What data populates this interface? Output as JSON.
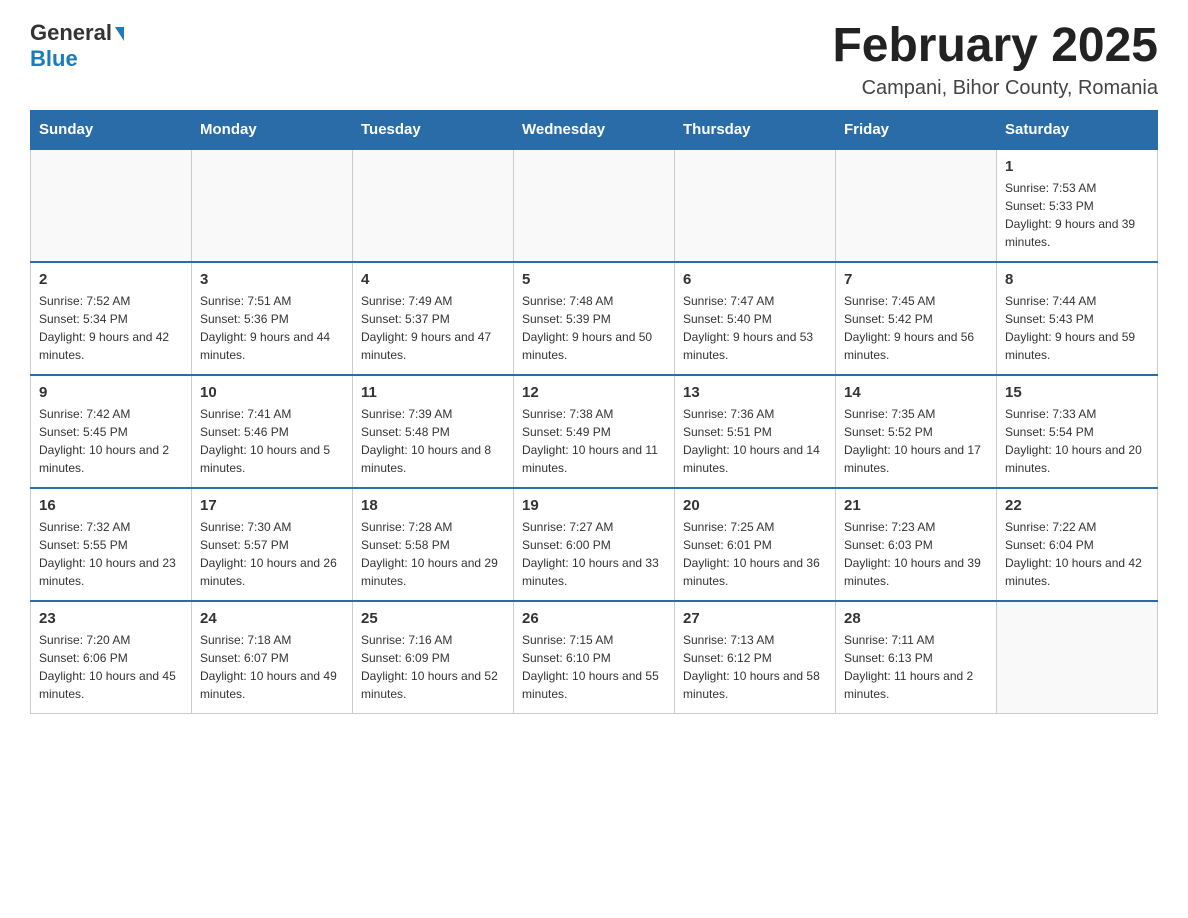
{
  "logo": {
    "general": "General",
    "blue": "Blue"
  },
  "title": "February 2025",
  "location": "Campani, Bihor County, Romania",
  "days_of_week": [
    "Sunday",
    "Monday",
    "Tuesday",
    "Wednesday",
    "Thursday",
    "Friday",
    "Saturday"
  ],
  "weeks": [
    [
      {
        "day": "",
        "info": ""
      },
      {
        "day": "",
        "info": ""
      },
      {
        "day": "",
        "info": ""
      },
      {
        "day": "",
        "info": ""
      },
      {
        "day": "",
        "info": ""
      },
      {
        "day": "",
        "info": ""
      },
      {
        "day": "1",
        "info": "Sunrise: 7:53 AM\nSunset: 5:33 PM\nDaylight: 9 hours and 39 minutes."
      }
    ],
    [
      {
        "day": "2",
        "info": "Sunrise: 7:52 AM\nSunset: 5:34 PM\nDaylight: 9 hours and 42 minutes."
      },
      {
        "day": "3",
        "info": "Sunrise: 7:51 AM\nSunset: 5:36 PM\nDaylight: 9 hours and 44 minutes."
      },
      {
        "day": "4",
        "info": "Sunrise: 7:49 AM\nSunset: 5:37 PM\nDaylight: 9 hours and 47 minutes."
      },
      {
        "day": "5",
        "info": "Sunrise: 7:48 AM\nSunset: 5:39 PM\nDaylight: 9 hours and 50 minutes."
      },
      {
        "day": "6",
        "info": "Sunrise: 7:47 AM\nSunset: 5:40 PM\nDaylight: 9 hours and 53 minutes."
      },
      {
        "day": "7",
        "info": "Sunrise: 7:45 AM\nSunset: 5:42 PM\nDaylight: 9 hours and 56 minutes."
      },
      {
        "day": "8",
        "info": "Sunrise: 7:44 AM\nSunset: 5:43 PM\nDaylight: 9 hours and 59 minutes."
      }
    ],
    [
      {
        "day": "9",
        "info": "Sunrise: 7:42 AM\nSunset: 5:45 PM\nDaylight: 10 hours and 2 minutes."
      },
      {
        "day": "10",
        "info": "Sunrise: 7:41 AM\nSunset: 5:46 PM\nDaylight: 10 hours and 5 minutes."
      },
      {
        "day": "11",
        "info": "Sunrise: 7:39 AM\nSunset: 5:48 PM\nDaylight: 10 hours and 8 minutes."
      },
      {
        "day": "12",
        "info": "Sunrise: 7:38 AM\nSunset: 5:49 PM\nDaylight: 10 hours and 11 minutes."
      },
      {
        "day": "13",
        "info": "Sunrise: 7:36 AM\nSunset: 5:51 PM\nDaylight: 10 hours and 14 minutes."
      },
      {
        "day": "14",
        "info": "Sunrise: 7:35 AM\nSunset: 5:52 PM\nDaylight: 10 hours and 17 minutes."
      },
      {
        "day": "15",
        "info": "Sunrise: 7:33 AM\nSunset: 5:54 PM\nDaylight: 10 hours and 20 minutes."
      }
    ],
    [
      {
        "day": "16",
        "info": "Sunrise: 7:32 AM\nSunset: 5:55 PM\nDaylight: 10 hours and 23 minutes."
      },
      {
        "day": "17",
        "info": "Sunrise: 7:30 AM\nSunset: 5:57 PM\nDaylight: 10 hours and 26 minutes."
      },
      {
        "day": "18",
        "info": "Sunrise: 7:28 AM\nSunset: 5:58 PM\nDaylight: 10 hours and 29 minutes."
      },
      {
        "day": "19",
        "info": "Sunrise: 7:27 AM\nSunset: 6:00 PM\nDaylight: 10 hours and 33 minutes."
      },
      {
        "day": "20",
        "info": "Sunrise: 7:25 AM\nSunset: 6:01 PM\nDaylight: 10 hours and 36 minutes."
      },
      {
        "day": "21",
        "info": "Sunrise: 7:23 AM\nSunset: 6:03 PM\nDaylight: 10 hours and 39 minutes."
      },
      {
        "day": "22",
        "info": "Sunrise: 7:22 AM\nSunset: 6:04 PM\nDaylight: 10 hours and 42 minutes."
      }
    ],
    [
      {
        "day": "23",
        "info": "Sunrise: 7:20 AM\nSunset: 6:06 PM\nDaylight: 10 hours and 45 minutes."
      },
      {
        "day": "24",
        "info": "Sunrise: 7:18 AM\nSunset: 6:07 PM\nDaylight: 10 hours and 49 minutes."
      },
      {
        "day": "25",
        "info": "Sunrise: 7:16 AM\nSunset: 6:09 PM\nDaylight: 10 hours and 52 minutes."
      },
      {
        "day": "26",
        "info": "Sunrise: 7:15 AM\nSunset: 6:10 PM\nDaylight: 10 hours and 55 minutes."
      },
      {
        "day": "27",
        "info": "Sunrise: 7:13 AM\nSunset: 6:12 PM\nDaylight: 10 hours and 58 minutes."
      },
      {
        "day": "28",
        "info": "Sunrise: 7:11 AM\nSunset: 6:13 PM\nDaylight: 11 hours and 2 minutes."
      },
      {
        "day": "",
        "info": ""
      }
    ]
  ]
}
